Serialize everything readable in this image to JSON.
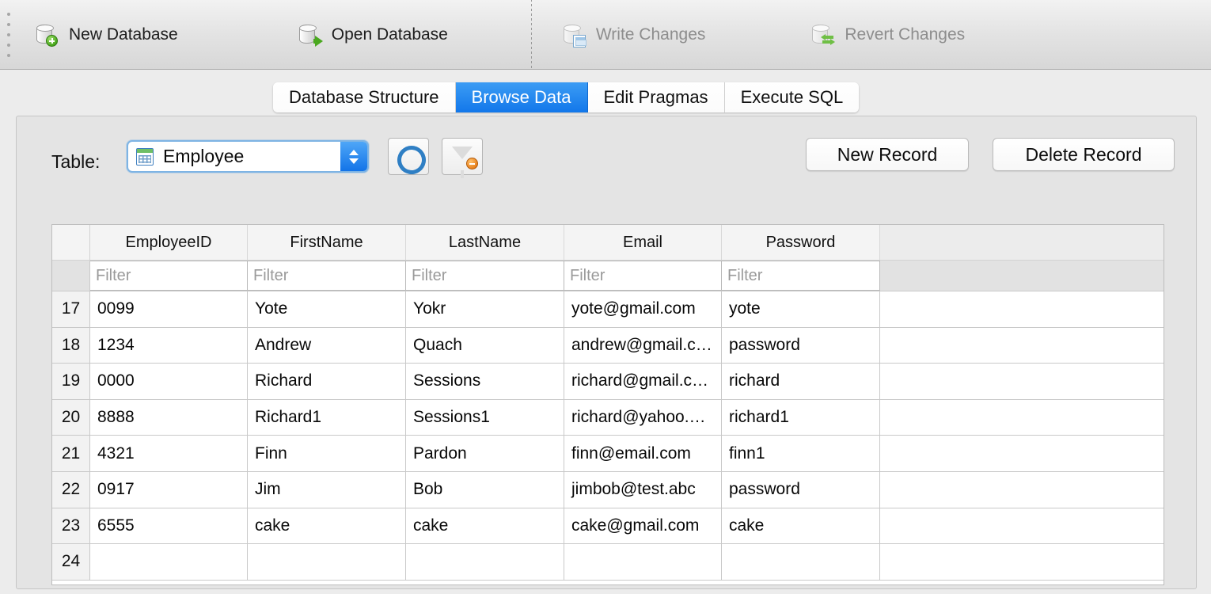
{
  "toolbar": {
    "items": [
      {
        "label": "New Database",
        "icon": "new-database-icon",
        "enabled": true
      },
      {
        "label": "Open Database",
        "icon": "open-database-icon",
        "enabled": true
      },
      {
        "label": "Write Changes",
        "icon": "write-changes-icon",
        "enabled": false
      },
      {
        "label": "Revert Changes",
        "icon": "revert-changes-icon",
        "enabled": false
      }
    ]
  },
  "tabs": [
    {
      "label": "Database Structure",
      "active": false
    },
    {
      "label": "Browse Data",
      "active": true
    },
    {
      "label": "Edit Pragmas",
      "active": false
    },
    {
      "label": "Execute SQL",
      "active": false
    }
  ],
  "browse": {
    "table_label": "Table:",
    "table_selected": "Employee",
    "refresh_icon": "refresh-icon",
    "clear_filter_icon": "clear-filter-icon",
    "new_record_label": "New Record",
    "delete_record_label": "Delete Record"
  },
  "grid": {
    "columns": [
      "EmployeeID",
      "FirstName",
      "LastName",
      "Email",
      "Password"
    ],
    "filter_placeholder": "Filter",
    "filter_values": [
      "",
      "",
      "",
      "",
      ""
    ],
    "rows": [
      {
        "num": "17",
        "cells": [
          "0099",
          "Yote",
          "Yokr",
          "yote@gmail.com",
          "yote"
        ]
      },
      {
        "num": "18",
        "cells": [
          "1234",
          "Andrew",
          "Quach",
          "andrew@gmail.c…",
          "password"
        ]
      },
      {
        "num": "19",
        "cells": [
          "0000",
          "Richard",
          "Sessions",
          "richard@gmail.c…",
          "richard"
        ]
      },
      {
        "num": "20",
        "cells": [
          "8888",
          "Richard1",
          "Sessions1",
          "richard@yahoo.…",
          "richard1"
        ]
      },
      {
        "num": "21",
        "cells": [
          "4321",
          "Finn",
          "Pardon",
          "finn@email.com",
          "finn1"
        ]
      },
      {
        "num": "22",
        "cells": [
          "0917",
          "Jim",
          "Bob",
          "jimbob@test.abc",
          "password"
        ]
      },
      {
        "num": "23",
        "cells": [
          "6555",
          "cake",
          "cake",
          "cake@gmail.com",
          "cake"
        ]
      },
      {
        "num": "24",
        "cells": [
          "",
          "",
          "",
          "",
          ""
        ]
      }
    ]
  },
  "colors": {
    "accent": "#1277ea",
    "toolbar_bg": "#e3e3e3",
    "panel_bg": "#e4e4e4"
  }
}
